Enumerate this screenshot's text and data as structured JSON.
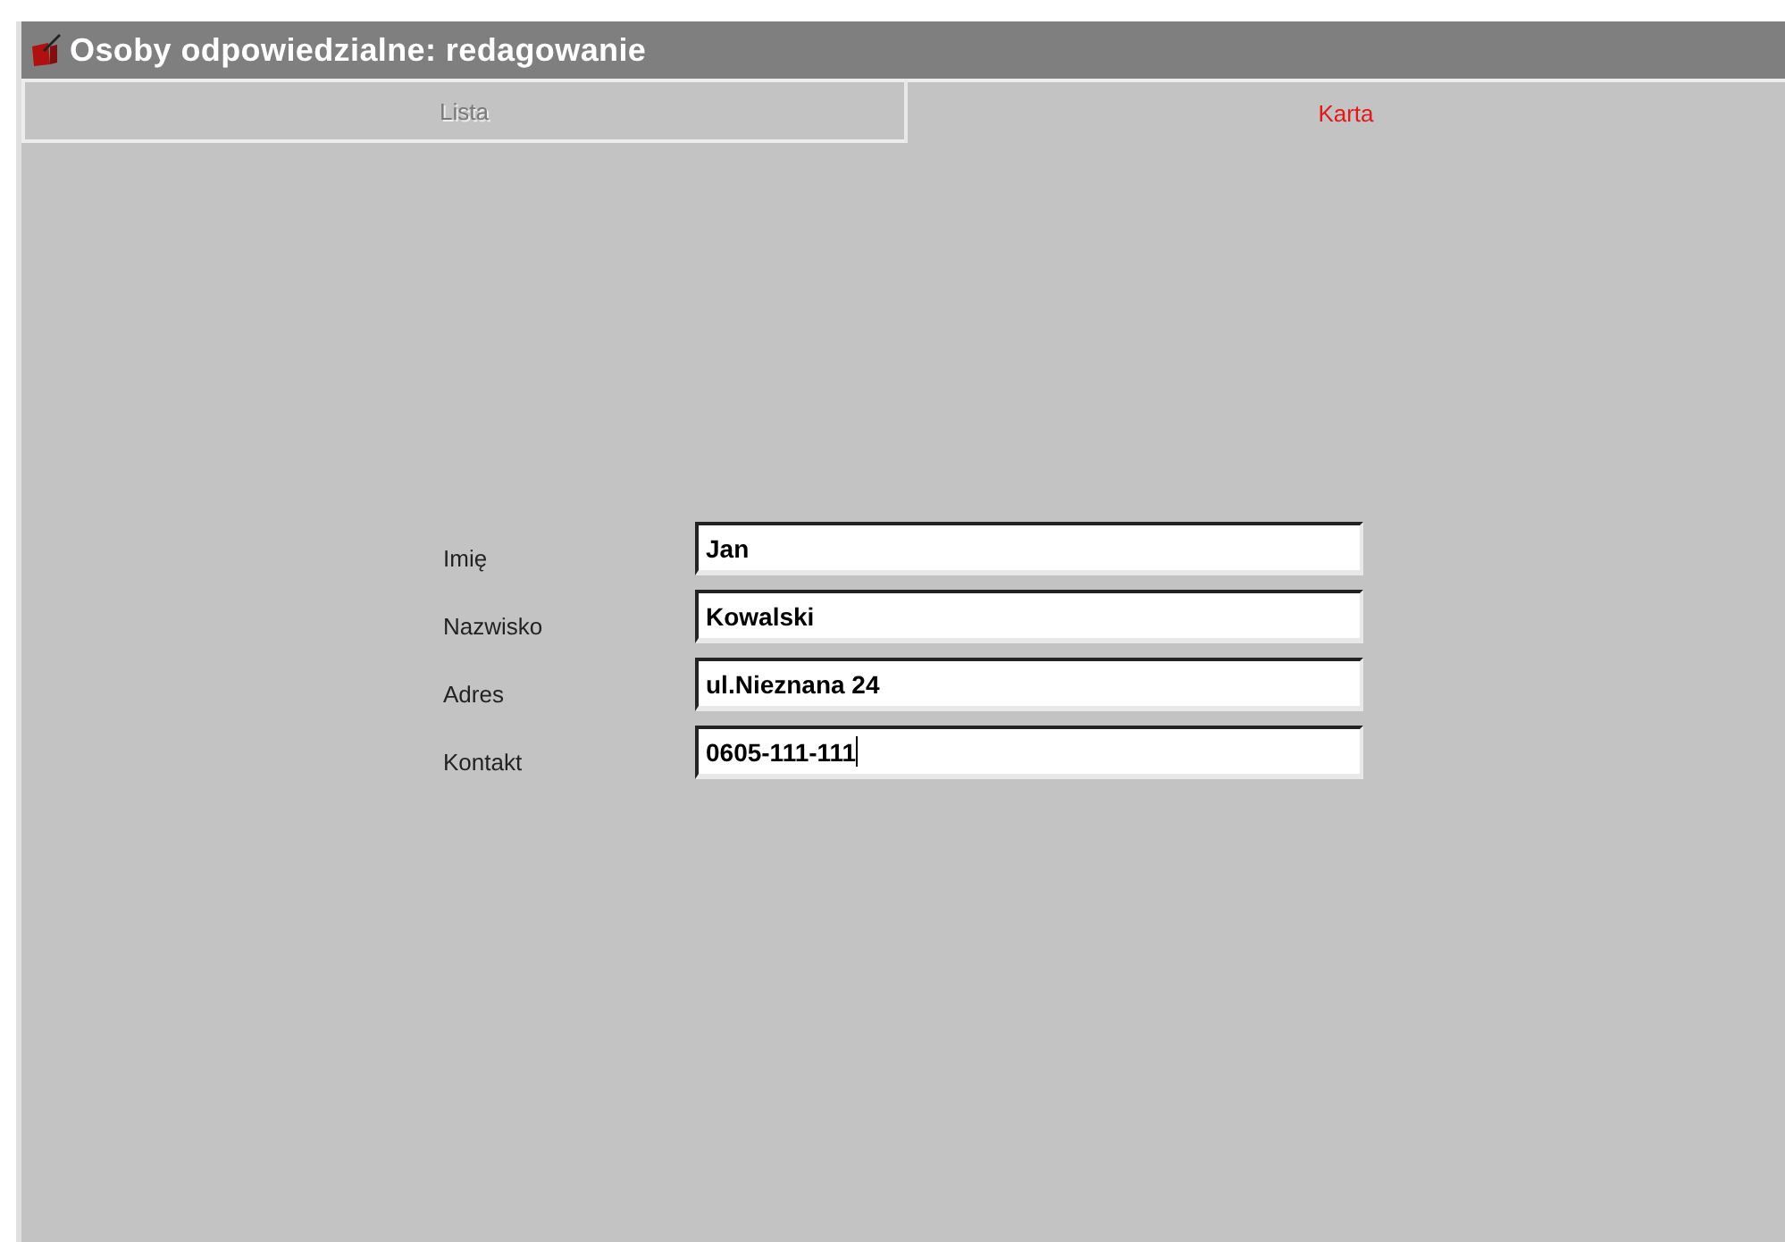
{
  "window": {
    "title": "Osoby odpowiedzialne: redagowanie"
  },
  "tabs": [
    {
      "label": "Lista",
      "selected": false
    },
    {
      "label": "Karta",
      "selected": true
    }
  ],
  "form": {
    "fields": [
      {
        "label": "Imię",
        "value": "Jan",
        "focused": false
      },
      {
        "label": "Nazwisko",
        "value": "Kowalski",
        "focused": false
      },
      {
        "label": "Adres",
        "value": "ul.Nieznana 24",
        "focused": false
      },
      {
        "label": "Kontakt",
        "value": "0605-111-111",
        "focused": true
      }
    ]
  }
}
